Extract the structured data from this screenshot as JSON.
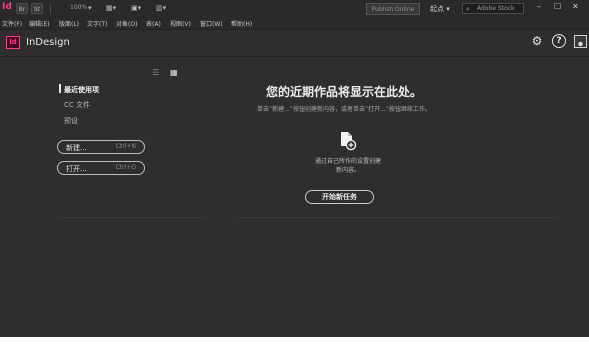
{
  "app": {
    "mini_logo": "Id",
    "name": "InDesign",
    "logo_text": "Id"
  },
  "toolbar": {
    "btn1": "Br",
    "btn2": "St",
    "zoom": "100%",
    "publish_online": "Publish Online",
    "workspace": "起点",
    "stock_placeholder": "Adobe Stock"
  },
  "menu": [
    "文件(F)",
    "编辑(E)",
    "版面(L)",
    "文字(T)",
    "对象(O)",
    "表(A)",
    "视图(V)",
    "窗口(W)",
    "帮助(H)"
  ],
  "left_panel": {
    "nav": [
      "最近使用项",
      "CC 文件",
      "预设"
    ],
    "new_button": {
      "label": "新建...",
      "shortcut": "Ctrl+N"
    },
    "open_button": {
      "label": "打开...",
      "shortcut": "Ctrl+O"
    }
  },
  "main": {
    "heading": "您的近期作品将显示在此处。",
    "subtext": "单击“新建...”按钮创建新内容，或者单击“打开...”按钮继续工作。",
    "hint_line1": "通过自己所作的设置创建",
    "hint_line2": "新内容。",
    "start_button": "开始新任务"
  },
  "colors": {
    "brand": "#ff3a8b",
    "background": "#2f2d2e"
  }
}
